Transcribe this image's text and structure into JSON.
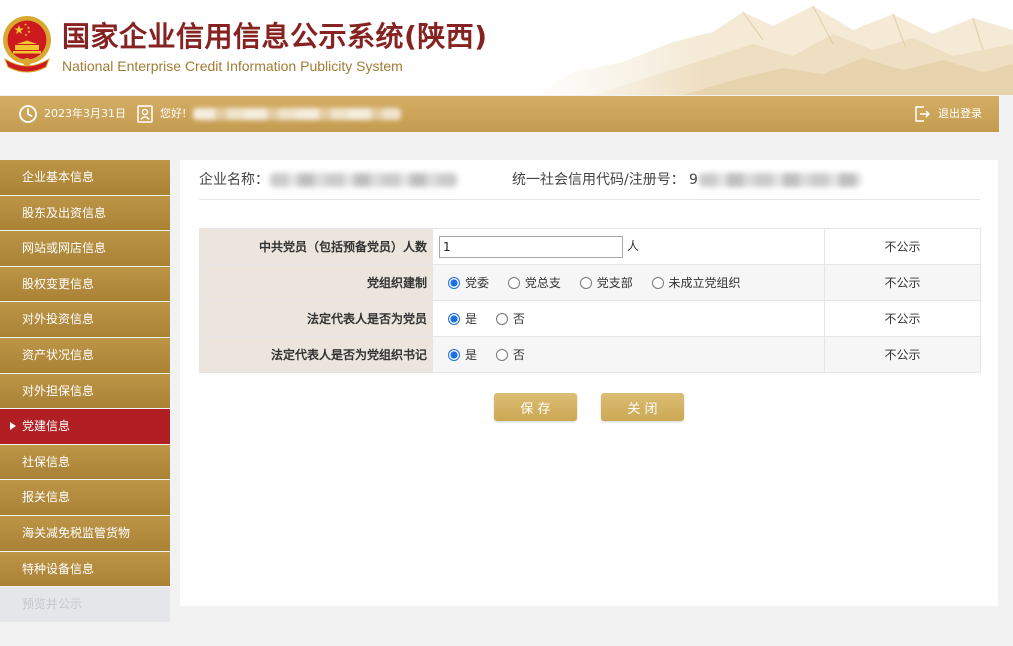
{
  "header": {
    "title": "国家企业信用信息公示系统(陕西)",
    "subtitle": "National Enterprise Credit Information Publicity System"
  },
  "topbar": {
    "date": "2023年3月31日",
    "greeting": "您好!",
    "logout_label": "退出登录"
  },
  "sidebar": {
    "items": [
      "企业基本信息",
      "股东及出资信息",
      "网站或网店信息",
      "股权变更信息",
      "对外投资信息",
      "资产状况信息",
      "对外担保信息",
      "党建信息",
      "社保信息",
      "报关信息",
      "海关减免税监管货物",
      "特种设备信息",
      "预览并公示"
    ],
    "active_index": 7,
    "disabled_index": 12
  },
  "company": {
    "name_label": "企业名称：",
    "code_label": "统一社会信用代码/注册号：",
    "code_prefix": "9"
  },
  "form": {
    "rows": [
      {
        "label": "中共党员（包括预备党员）人数",
        "value": "1",
        "unit": "人",
        "publicity": "不公示"
      },
      {
        "label": "党组织建制",
        "options": [
          "党委",
          "党总支",
          "党支部",
          "未成立党组织"
        ],
        "selected": 0,
        "publicity": "不公示"
      },
      {
        "label": "法定代表人是否为党员",
        "options": [
          "是",
          "否"
        ],
        "selected": 0,
        "publicity": "不公示"
      },
      {
        "label": "法定代表人是否为党组织书记",
        "options": [
          "是",
          "否"
        ],
        "selected": 0,
        "publicity": "不公示"
      }
    ]
  },
  "buttons": {
    "save": "保 存",
    "close": "关 闭"
  },
  "colors": {
    "title": "#862322",
    "subtitle": "#a07c35",
    "gold": "#c9a158",
    "active_red": "#b11f23",
    "radio": "#1a6fe0"
  },
  "icons": [
    "national-emblem-icon",
    "clock-icon",
    "user-icon",
    "logout-icon",
    "active-indicator-icon"
  ]
}
